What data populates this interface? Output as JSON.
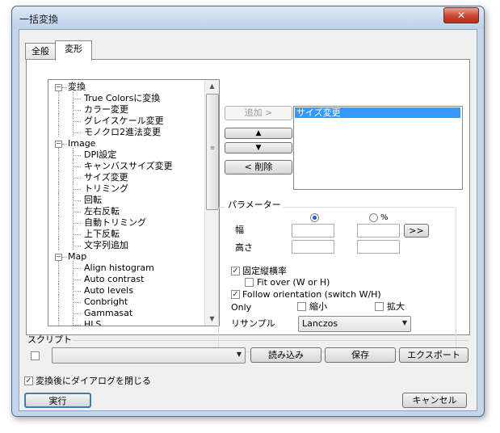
{
  "window": {
    "title": "一括変換",
    "close_glyph": "✕"
  },
  "tabs": [
    {
      "label": "全般"
    },
    {
      "label": "変形"
    }
  ],
  "tree": {
    "items": [
      {
        "label": "変換",
        "level": 0,
        "expander": "−"
      },
      {
        "label": "True Colorsに変換",
        "level": 1
      },
      {
        "label": "カラー変更",
        "level": 1
      },
      {
        "label": "グレイスケール変更",
        "level": 1
      },
      {
        "label": "モノクロ2進法変更",
        "level": 1
      },
      {
        "label": "Image",
        "level": 0,
        "expander": "−"
      },
      {
        "label": "DPI設定",
        "level": 1
      },
      {
        "label": "キャンバスサイズ変更",
        "level": 1
      },
      {
        "label": "サイズ変更",
        "level": 1
      },
      {
        "label": "トリミング",
        "level": 1
      },
      {
        "label": "回転",
        "level": 1
      },
      {
        "label": "左右反転",
        "level": 1
      },
      {
        "label": "自動トリミング",
        "level": 1
      },
      {
        "label": "上下反転",
        "level": 1
      },
      {
        "label": "文字列追加",
        "level": 1
      },
      {
        "label": "Map",
        "level": 0,
        "expander": "−"
      },
      {
        "label": "Align histogram",
        "level": 1
      },
      {
        "label": "Auto contrast",
        "level": 1
      },
      {
        "label": "Auto levels",
        "level": 1
      },
      {
        "label": "Conbright",
        "level": 1
      },
      {
        "label": "Gammasat",
        "level": 1
      },
      {
        "label": "HLS",
        "level": 1
      }
    ],
    "scroll_up_glyph": "▲",
    "scroll_down_glyph": "▼",
    "grip_glyph": "≡"
  },
  "actions": {
    "add_label": "追加 >",
    "move_up_glyph": "▲",
    "move_down_glyph": "▼",
    "remove_label": "< 削除"
  },
  "selected_list": {
    "items": [
      "サイズ変更"
    ]
  },
  "params": {
    "group_label": "パラメーター",
    "unit_px_label": "",
    "unit_pct_label": "%",
    "unit_selected": "px",
    "width_label": "幅",
    "height_label": "高さ",
    "width_px": "",
    "height_px": "",
    "width_pct": "",
    "height_pct": "",
    "link_button": ">>",
    "keep_ratio_label": "固定縦横率",
    "keep_ratio_checked": true,
    "fit_over_label": "Fit over (W or H)",
    "fit_over_checked": false,
    "follow_orientation_label": "Follow orientation (switch W/H)",
    "follow_orientation_checked": true,
    "only_label": "Only",
    "shrink_label": "縮小",
    "enlarge_label": "拡大",
    "resample_label": "リサンプル",
    "resample_value": "Lanczos"
  },
  "script": {
    "label": "スクリプト",
    "combo_value": "",
    "load_button": "読み込み",
    "save_button": "保存",
    "export_button": "エクスポート"
  },
  "footer": {
    "close_after_label": "変換後にダイアログを閉じる",
    "close_after_checked": true,
    "run_button": "実行",
    "cancel_button": "キャンセル"
  },
  "common": {
    "check_glyph": "✓",
    "combo_arrow_glyph": "▼"
  }
}
